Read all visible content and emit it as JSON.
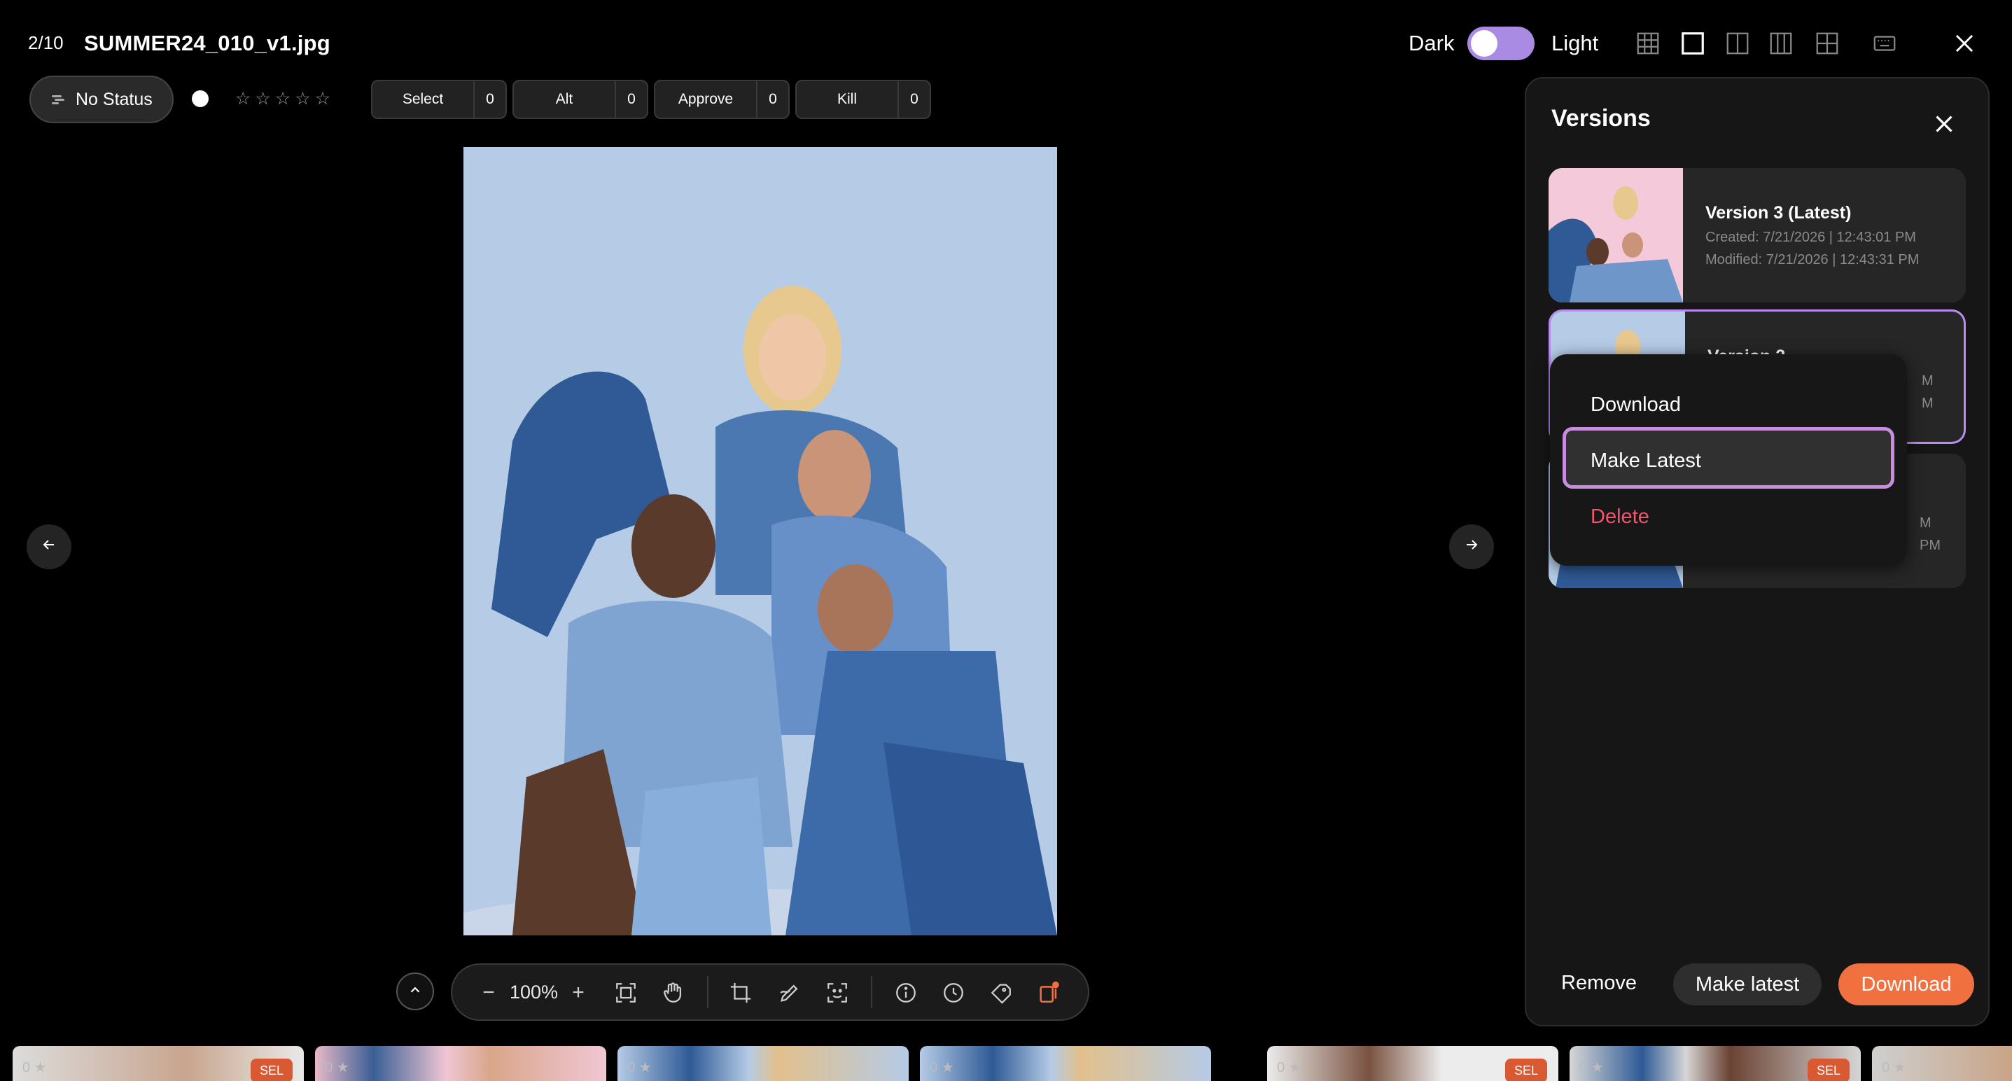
{
  "header": {
    "counter": "2/10",
    "filename": "SUMMER24_010_v1.jpg",
    "theme_dark_label": "Dark",
    "theme_light_label": "Light",
    "view_icons": [
      "grid-view-icon",
      "single-view-icon",
      "compare-two-icon",
      "compare-three-icon",
      "compare-four-icon",
      "keyboard-icon",
      "close-icon"
    ]
  },
  "status": {
    "label": "No Status",
    "rating_stars": 0,
    "star_glyph": "☆",
    "buckets": [
      {
        "label": "Select",
        "count": "0"
      },
      {
        "label": "Alt",
        "count": "0"
      },
      {
        "label": "Approve",
        "count": "0"
      },
      {
        "label": "Kill",
        "count": "0"
      }
    ]
  },
  "toolbar": {
    "zoom_out": "−",
    "zoom_level": "100%",
    "zoom_in": "+",
    "tools": [
      "fit-screen-icon",
      "pan-hand-icon",
      "crop-icon",
      "annotate-icon",
      "focus-scan-icon",
      "info-icon",
      "history-icon",
      "tags-icon",
      "versions-icon"
    ]
  },
  "filmstrip": {
    "items": [
      {
        "count": "0 ★",
        "badge": "SEL"
      },
      {
        "count": "0 ★",
        "badge": ""
      },
      {
        "count": "0 ★",
        "badge": ""
      },
      {
        "count": "0 ★",
        "badge": ""
      },
      {
        "count": "0 ★",
        "badge": "SEL"
      },
      {
        "count": "0 ★",
        "badge": "SEL"
      },
      {
        "count": "0 ★",
        "badge": ""
      }
    ]
  },
  "versions_panel": {
    "title": "Versions",
    "versions": [
      {
        "title": "Version 3 (Latest)",
        "created": "Created: 7/21/2026 | 12:43:01 PM",
        "modified": "Modified: 7/21/2026 | 12:43:31 PM"
      },
      {
        "title": "Version 2",
        "created": "M",
        "modified": "M"
      },
      {
        "title": "",
        "created": "M",
        "modified": "PM"
      }
    ],
    "context_menu": {
      "download": "Download",
      "make_latest": "Make Latest",
      "delete": "Delete"
    },
    "footer": {
      "remove": "Remove",
      "make_latest": "Make latest",
      "download": "Download"
    }
  },
  "colors": {
    "accent_orange": "#f0703f",
    "accent_purple": "#b88cf0",
    "danger": "#f0566e",
    "photo_background": "#b5cbe6"
  }
}
